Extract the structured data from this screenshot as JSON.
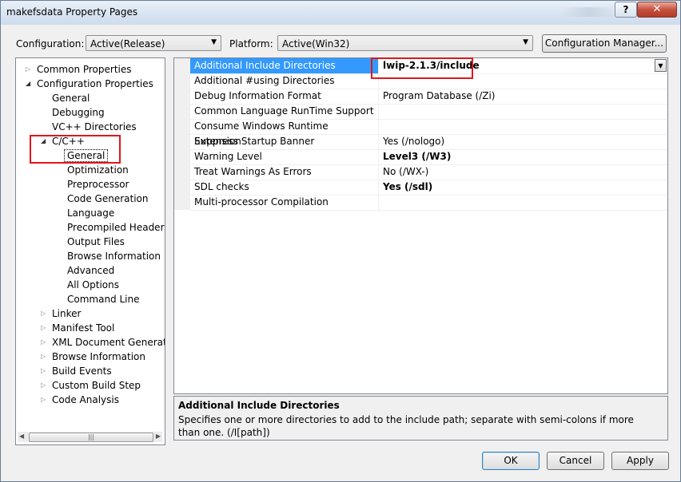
{
  "window": {
    "title": "makefsdata Property Pages",
    "help_label": "?",
    "close_label": "✕"
  },
  "toolbar": {
    "configuration_label": "Configuration:",
    "configuration_value": "Active(Release)",
    "platform_label": "Platform:",
    "platform_value": "Active(Win32)",
    "config_manager_label": "Configuration Manager..."
  },
  "tree": {
    "items": [
      {
        "label": "Common Properties",
        "expander": "collapsed"
      },
      {
        "label": "Configuration Properties",
        "expander": "expanded"
      },
      {
        "label": "General",
        "expander": "none"
      },
      {
        "label": "Debugging",
        "expander": "none"
      },
      {
        "label": "VC++ Directories",
        "expander": "none"
      },
      {
        "label": "C/C++",
        "expander": "expanded"
      },
      {
        "label": "General",
        "expander": "none",
        "selected": true
      },
      {
        "label": "Optimization",
        "expander": "none"
      },
      {
        "label": "Preprocessor",
        "expander": "none"
      },
      {
        "label": "Code Generation",
        "expander": "none"
      },
      {
        "label": "Language",
        "expander": "none"
      },
      {
        "label": "Precompiled Headers",
        "expander": "none"
      },
      {
        "label": "Output Files",
        "expander": "none"
      },
      {
        "label": "Browse Information",
        "expander": "none"
      },
      {
        "label": "Advanced",
        "expander": "none"
      },
      {
        "label": "All Options",
        "expander": "none"
      },
      {
        "label": "Command Line",
        "expander": "none"
      },
      {
        "label": "Linker",
        "expander": "collapsed"
      },
      {
        "label": "Manifest Tool",
        "expander": "collapsed"
      },
      {
        "label": "XML Document Generator",
        "expander": "collapsed"
      },
      {
        "label": "Browse Information",
        "expander": "collapsed"
      },
      {
        "label": "Build Events",
        "expander": "collapsed"
      },
      {
        "label": "Custom Build Step",
        "expander": "collapsed"
      },
      {
        "label": "Code Analysis",
        "expander": "collapsed"
      }
    ]
  },
  "grid": {
    "rows": [
      {
        "name": "Additional Include Directories",
        "value": "lwip-2.1.3/include",
        "bold": true,
        "selected": true
      },
      {
        "name": "Additional #using Directories",
        "value": ""
      },
      {
        "name": "Debug Information Format",
        "value": "Program Database (/Zi)"
      },
      {
        "name": "Common Language RunTime Support",
        "value": ""
      },
      {
        "name": "Consume Windows Runtime Extension",
        "value": ""
      },
      {
        "name": "Suppress Startup Banner",
        "value": "Yes (/nologo)"
      },
      {
        "name": "Warning Level",
        "value": "Level3 (/W3)",
        "bold": true
      },
      {
        "name": "Treat Warnings As Errors",
        "value": "No (/WX-)"
      },
      {
        "name": "SDL checks",
        "value": "Yes (/sdl)",
        "bold": true
      },
      {
        "name": "Multi-processor Compilation",
        "value": ""
      }
    ]
  },
  "description": {
    "title": "Additional Include Directories",
    "text": "Specifies one or more directories to add to the include path; separate with semi-colons if more than one. (/I[path])"
  },
  "buttons": {
    "ok": "OK",
    "cancel": "Cancel",
    "apply": "Apply"
  },
  "colors": {
    "selection": "#3399ff",
    "highlight_box": "#e0161c"
  }
}
